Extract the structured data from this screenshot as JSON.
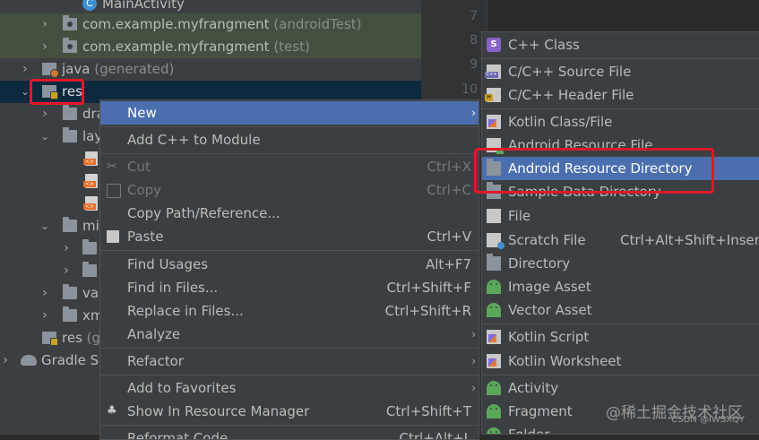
{
  "tree": {
    "main_activity": "MainActivity",
    "pkg_android_test": {
      "name": "com.example.myfrangment",
      "suffix": "(androidTest)"
    },
    "pkg_test": {
      "name": "com.example.myfrangment",
      "suffix": "(test)"
    },
    "java_generated": {
      "name": "java",
      "suffix": "(generated)"
    },
    "res": "res",
    "drawable": "dra",
    "layout": "lay",
    "mipmap": "mi",
    "values": "val",
    "xml": "xm",
    "res_generated": {
      "name": "res",
      "suffix": "(g"
    },
    "gradle_scripts": "Gradle Sc"
  },
  "editor": {
    "line_numbers": [
      "7",
      "8",
      "9",
      "10"
    ]
  },
  "context_menu": {
    "items": [
      {
        "label": "New",
        "shortcut": "",
        "submenu": true
      },
      {
        "label": "Add C++ to Module",
        "shortcut": ""
      },
      {
        "label": "Cut",
        "shortcut": "Ctrl+X"
      },
      {
        "label": "Copy",
        "shortcut": "Ctrl+C"
      },
      {
        "label": "Copy Path/Reference...",
        "shortcut": ""
      },
      {
        "label": "Paste",
        "shortcut": "Ctrl+V"
      },
      {
        "label": "Find Usages",
        "shortcut": "Alt+F7"
      },
      {
        "label": "Find in Files...",
        "shortcut": "Ctrl+Shift+F"
      },
      {
        "label": "Replace in Files...",
        "shortcut": "Ctrl+Shift+R"
      },
      {
        "label": "Analyze",
        "shortcut": "",
        "submenu": true
      },
      {
        "label": "Refactor",
        "shortcut": "",
        "submenu": true
      },
      {
        "label": "Add to Favorites",
        "shortcut": "",
        "submenu": true
      },
      {
        "label": "Show In Resource Manager",
        "shortcut": "Ctrl+Shift+T"
      },
      {
        "label": "Reformat Code",
        "shortcut": "Ctrl+Alt+L"
      }
    ],
    "submenu_arrow": "›"
  },
  "new_submenu": {
    "items": [
      {
        "label": "C++ Class",
        "icon": "cpp-class-icon"
      },
      {
        "label": "C/C++ Source File",
        "icon": "cpp-source-file-icon"
      },
      {
        "label": "C/C++ Header File",
        "icon": "cpp-header-file-icon"
      },
      {
        "label": "Kotlin Class/File",
        "icon": "kotlin-class-icon"
      },
      {
        "label": "Android Resource File",
        "icon": "android-resource-file-icon"
      },
      {
        "label": "Android Resource Directory",
        "icon": "folder-icon"
      },
      {
        "label": "Sample Data Directory",
        "icon": "folder-icon"
      },
      {
        "label": "File",
        "icon": "file-icon"
      },
      {
        "label": "Scratch File",
        "icon": "scratch-file-icon",
        "shortcut": "Ctrl+Alt+Shift+Insert"
      },
      {
        "label": "Directory",
        "icon": "folder-icon"
      },
      {
        "label": "Image Asset",
        "icon": "android-icon"
      },
      {
        "label": "Vector Asset",
        "icon": "android-icon"
      },
      {
        "label": "Kotlin Script",
        "icon": "kotlin-script-icon"
      },
      {
        "label": "Kotlin Worksheet",
        "icon": "kotlin-worksheet-icon"
      },
      {
        "label": "Activity",
        "icon": "android-icon",
        "submenu": true
      },
      {
        "label": "Fragment",
        "icon": "android-icon",
        "submenu": true
      },
      {
        "label": "Folder",
        "icon": "android-icon",
        "submenu": true
      }
    ]
  },
  "watermark": {
    "line1": "@稀土掘金技术社区",
    "line2": "CSDN @IWSXQY"
  },
  "colors": {
    "highlight": "#4b6eaf",
    "annotation_red": "#e0182b",
    "panel": "#3c3f41",
    "editor_bg": "#2b2b2b"
  }
}
